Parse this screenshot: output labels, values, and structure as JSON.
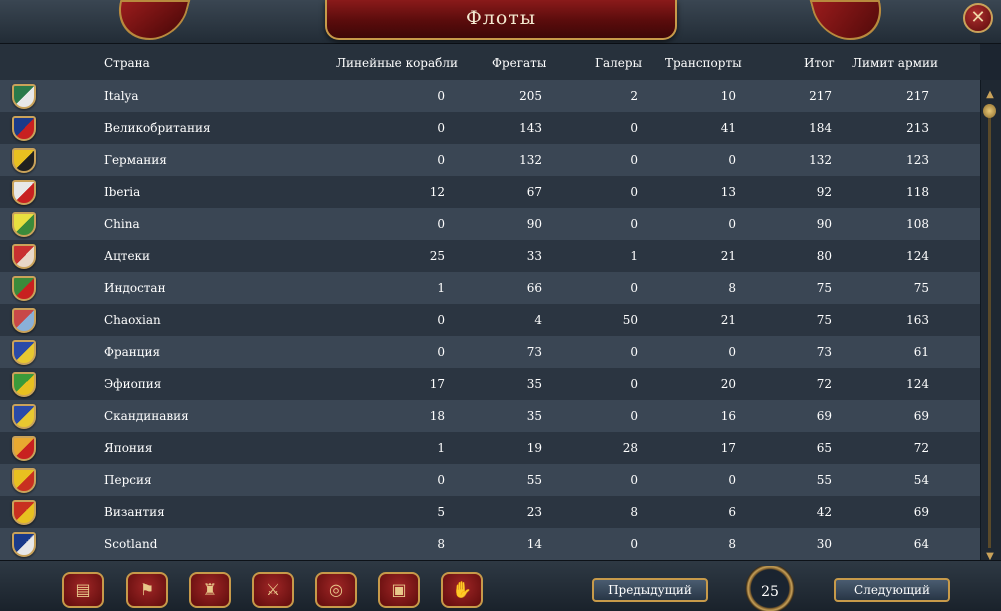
{
  "window": {
    "title": "Флоты",
    "close_icon": "close-icon"
  },
  "columns": {
    "country": "Страна",
    "ships_of_line": "Линейные корабли",
    "frigates": "Фрегаты",
    "galleys": "Галеры",
    "transports": "Транспорты",
    "total": "Итог",
    "limit": "Лимит армии"
  },
  "rows": [
    {
      "name": "Italya",
      "shield_colors": [
        "#2a7a4a",
        "#e8e8e8"
      ],
      "ships_of_line": "0",
      "frigates": "205",
      "galleys": "2",
      "transports": "10",
      "total": "217",
      "limit": "217"
    },
    {
      "name": "Великобритания",
      "shield_colors": [
        "#1a3a8a",
        "#c82020"
      ],
      "ships_of_line": "0",
      "frigates": "143",
      "galleys": "0",
      "transports": "41",
      "total": "184",
      "limit": "213"
    },
    {
      "name": "Германия",
      "shield_colors": [
        "#e8c020",
        "#202020"
      ],
      "ships_of_line": "0",
      "frigates": "132",
      "galleys": "0",
      "transports": "0",
      "total": "132",
      "limit": "123"
    },
    {
      "name": "Iberia",
      "shield_colors": [
        "#e8e8e8",
        "#c82020"
      ],
      "ships_of_line": "12",
      "frigates": "67",
      "galleys": "0",
      "transports": "13",
      "total": "92",
      "limit": "118"
    },
    {
      "name": "China",
      "shield_colors": [
        "#e8e040",
        "#3a8a3a"
      ],
      "ships_of_line": "0",
      "frigates": "90",
      "galleys": "0",
      "transports": "0",
      "total": "90",
      "limit": "108"
    },
    {
      "name": "Ацтеки",
      "shield_colors": [
        "#c83030",
        "#e8d8c8"
      ],
      "ships_of_line": "25",
      "frigates": "33",
      "galleys": "1",
      "transports": "21",
      "total": "80",
      "limit": "124"
    },
    {
      "name": "Индостан",
      "shield_colors": [
        "#3a8a3a",
        "#c82020"
      ],
      "ships_of_line": "1",
      "frigates": "66",
      "galleys": "0",
      "transports": "8",
      "total": "75",
      "limit": "75"
    },
    {
      "name": "Chaoxian",
      "shield_colors": [
        "#c84848",
        "#8ab0d8"
      ],
      "ships_of_line": "0",
      "frigates": "4",
      "galleys": "50",
      "transports": "21",
      "total": "75",
      "limit": "163"
    },
    {
      "name": "Франция",
      "shield_colors": [
        "#2a4aa8",
        "#e8c830"
      ],
      "ships_of_line": "0",
      "frigates": "73",
      "galleys": "0",
      "transports": "0",
      "total": "73",
      "limit": "61"
    },
    {
      "name": "Эфиопия",
      "shield_colors": [
        "#3a9a3a",
        "#e8c020"
      ],
      "ships_of_line": "17",
      "frigates": "35",
      "galleys": "0",
      "transports": "20",
      "total": "72",
      "limit": "124"
    },
    {
      "name": "Скандинавия",
      "shield_colors": [
        "#2a4aa8",
        "#e8c830"
      ],
      "ships_of_line": "18",
      "frigates": "35",
      "galleys": "0",
      "transports": "16",
      "total": "69",
      "limit": "69"
    },
    {
      "name": "Япония",
      "shield_colors": [
        "#e8a830",
        "#c82020"
      ],
      "ships_of_line": "1",
      "frigates": "19",
      "galleys": "28",
      "transports": "17",
      "total": "65",
      "limit": "72"
    },
    {
      "name": "Персия",
      "shield_colors": [
        "#e8c020",
        "#c83020"
      ],
      "ships_of_line": "0",
      "frigates": "55",
      "galleys": "0",
      "transports": "0",
      "total": "55",
      "limit": "54"
    },
    {
      "name": "Византия",
      "shield_colors": [
        "#c83020",
        "#e8c020"
      ],
      "ships_of_line": "5",
      "frigates": "23",
      "galleys": "8",
      "transports": "6",
      "total": "42",
      "limit": "69"
    },
    {
      "name": "Scotland",
      "shield_colors": [
        "#1a3a8a",
        "#e8e8e8"
      ],
      "ships_of_line": "8",
      "frigates": "14",
      "galleys": "0",
      "transports": "8",
      "total": "30",
      "limit": "64"
    }
  ],
  "toolbar": {
    "buttons": [
      {
        "icon": "scroll-icon",
        "glyph": "▤"
      },
      {
        "icon": "flag-icon",
        "glyph": "⚑"
      },
      {
        "icon": "army-icon",
        "glyph": "♜"
      },
      {
        "icon": "crossed-swords-icon",
        "glyph": "⚔"
      },
      {
        "icon": "coins-icon",
        "glyph": "◎"
      },
      {
        "icon": "crate-icon",
        "glyph": "▣"
      },
      {
        "icon": "handshake-icon",
        "glyph": "✋"
      }
    ]
  },
  "pagination": {
    "prev_label": "Предыдущий",
    "page": "25",
    "next_label": "Следующий"
  }
}
